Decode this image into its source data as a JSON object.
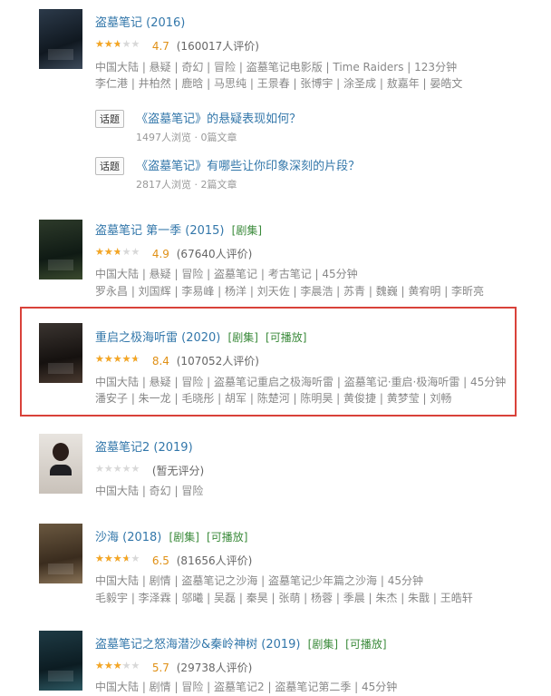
{
  "items": [
    {
      "title": "盗墓笔记",
      "year": "(2016)",
      "tags": [],
      "rating": 4.7,
      "rating_label": "4.7",
      "count_label": "(160017人评价)",
      "meta1": "中国大陆 | 悬疑 | 奇幻 | 冒险 | 盗墓笔记电影版 | Time Raiders | 123分钟",
      "meta2": "李仁港 | 井柏然 | 鹿晗 | 马思纯 | 王景春 | 张博宇 | 涂圣成 | 敖嘉年 | 晏皓文"
    },
    {
      "title": "盗墓笔记 第一季",
      "year": "(2015)",
      "tags": [
        "[剧集]"
      ],
      "rating": 4.9,
      "rating_label": "4.9",
      "count_label": "(67640人评价)",
      "meta1": "中国大陆 | 悬疑 | 冒险 | 盗墓笔记 | 考古笔记 | 45分钟",
      "meta2": "罗永昌 | 刘国辉 | 李易峰 | 杨洋 | 刘天佐 | 李晨浩 | 苏青 | 魏巍 | 黄宥明 | 李昕亮"
    },
    {
      "title": "重启之极海听雷",
      "year": "(2020)",
      "tags": [
        "[剧集]",
        "[可播放]"
      ],
      "rating": 8.4,
      "rating_label": "8.4",
      "count_label": "(107052人评价)",
      "meta1": "中国大陆 | 悬疑 | 冒险 | 盗墓笔记重启之极海听雷 | 盗墓笔记·重启·极海听雷 | 45分钟",
      "meta2": "潘安子 | 朱一龙 | 毛晓彤 | 胡军 | 陈楚河 | 陈明昊 | 黄俊捷 | 黄梦莹 | 刘畅"
    },
    {
      "title": "盗墓笔记2",
      "year": "(2019)",
      "tags": [],
      "rating": 0,
      "rating_label": "",
      "count_label": "(暂无评分)",
      "meta1": "中国大陆 | 奇幻 | 冒险",
      "meta2": ""
    },
    {
      "title": "沙海",
      "year": "(2018)",
      "tags": [
        "[剧集]",
        "[可播放]"
      ],
      "rating": 6.5,
      "rating_label": "6.5",
      "count_label": "(81656人评价)",
      "meta1": "中国大陆 | 剧情 | 盗墓笔记之沙海 | 盗墓笔记少年篇之沙海 | 45分钟",
      "meta2": "毛毅宇 | 李泽霖 | 邬曦 | 吴磊 | 秦昊 | 张萌 | 杨蓉 | 季晨 | 朱杰 | 朱戬 | 王皓轩"
    },
    {
      "title": "盗墓笔记之怒海潜沙&秦岭神树",
      "year": "(2019)",
      "tags": [
        "[剧集]",
        "[可播放]"
      ],
      "rating": 5.7,
      "rating_label": "5.7",
      "count_label": "(29738人评价)",
      "meta1": "中国大陆 | 剧情 | 冒险 | 盗墓笔记2 | 盗墓笔记第二季 | 45分钟",
      "meta2": ""
    }
  ],
  "topics": [
    {
      "badge": "话题",
      "title": "《盗墓笔记》的悬疑表现如何？",
      "meta": "1497人浏览 · 0篇文章"
    },
    {
      "badge": "话题",
      "title": "《盗墓笔记》有哪些让你印象深刻的片段？",
      "meta": "2817人浏览 · 2篇文章"
    }
  ],
  "colors": {
    "link": "#3377aa",
    "tag_green": "#3a8a3a",
    "star": "#f5a623",
    "highlight_border": "#d9423a"
  }
}
